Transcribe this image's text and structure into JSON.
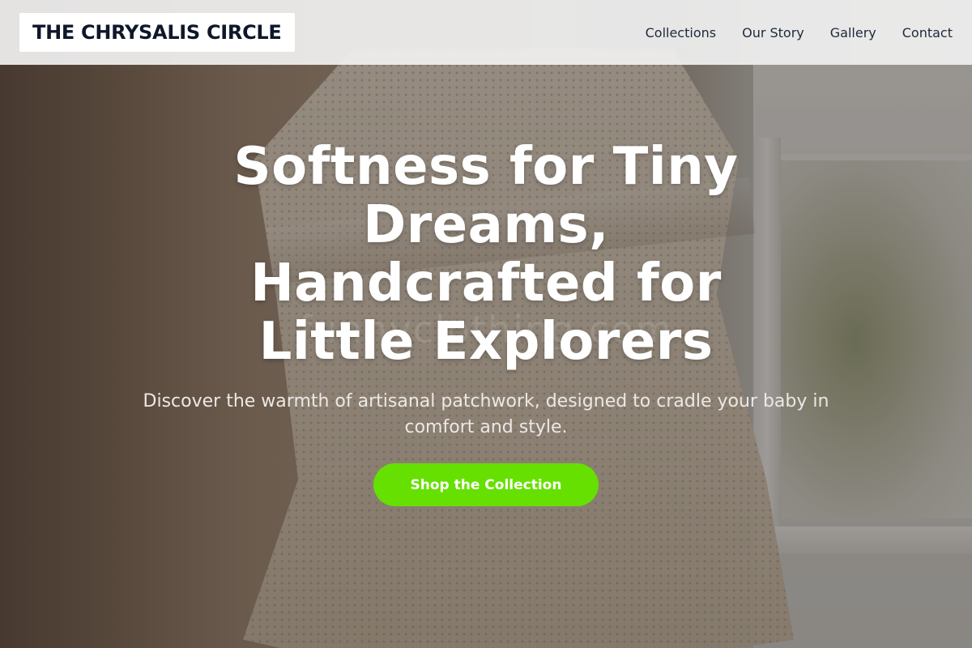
{
  "brand": {
    "name": "THE CHRYSALIS CIRCLE"
  },
  "nav": {
    "items": [
      {
        "label": "Collections"
      },
      {
        "label": "Our Story"
      },
      {
        "label": "Gallery"
      },
      {
        "label": "Contact"
      }
    ]
  },
  "hero": {
    "headline": "Softness for Tiny Dreams, Handcrafted for Little Explorers",
    "subheadline": "Discover the warmth of artisanal patchwork, designed to cradle your baby in comfort and style.",
    "cta_label": "Shop the Collection",
    "watermark": "funnyclothing.com"
  },
  "colors": {
    "cta_background": "#66e000",
    "cta_text": "#ffffff",
    "logo_text": "#0f172a",
    "nav_background": "#f0f0f0"
  }
}
